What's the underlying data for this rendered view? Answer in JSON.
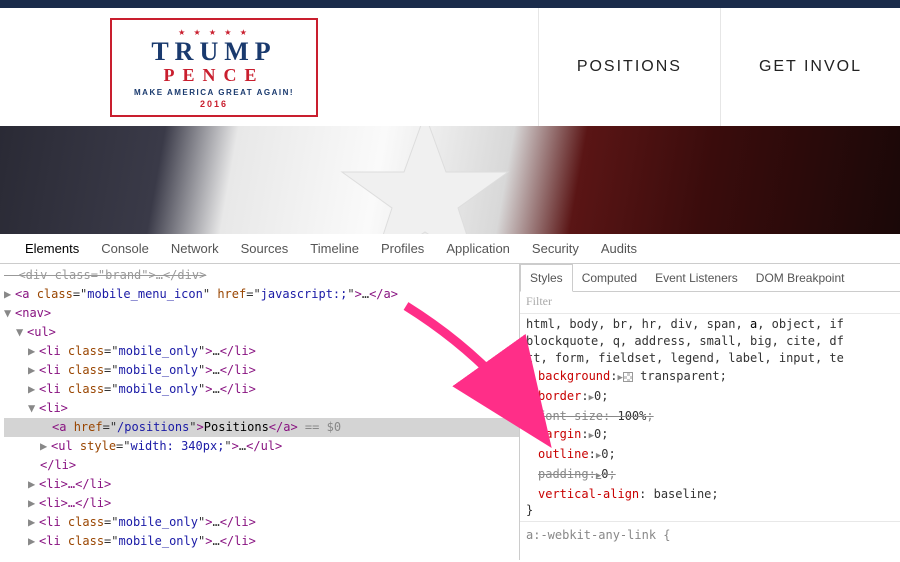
{
  "header": {
    "logo": {
      "stars": "★ ★ ★ ★ ★",
      "main": "TRUMP",
      "sub": "PENCE",
      "slogan": "MAKE AMERICA GREAT AGAIN!",
      "year": "2016"
    },
    "nav": [
      "POSITIONS",
      "GET INVOL"
    ]
  },
  "devtools": {
    "tabs": [
      "Elements",
      "Console",
      "Network",
      "Sources",
      "Timeline",
      "Profiles",
      "Application",
      "Security",
      "Audits"
    ],
    "active_tab": 0,
    "elements": {
      "l0": {
        "pre": "<div class=\"",
        "cls": "brand",
        "post": "\">…</div>"
      },
      "l1": {
        "pre": "<a class=\"",
        "cls": "mobile_menu_icon",
        "mid": "\" href=\"",
        "href": "javascript:;",
        "post": "\">…</a>"
      },
      "l2": "<nav>",
      "l3": "<ul>",
      "mo": {
        "pre": "<li class=\"",
        "cls": "mobile_only",
        "post": "\">…</li>"
      },
      "l7": "<li>",
      "sel": {
        "pre": "<a href=\"",
        "href": "/positions",
        "mid": "\">",
        "text": "Positions",
        "post": "</a>",
        "eq": " == $0"
      },
      "l9": {
        "pre": "<ul style=\"",
        "sty": "width: 340px;",
        "post": "\">…</ul>"
      },
      "l10": "</li>",
      "l11": "<li>…</li>"
    },
    "styles": {
      "tabs": [
        "Styles",
        "Computed",
        "Event Listeners",
        "DOM Breakpoint"
      ],
      "filter": "Filter",
      "selector": "html, body, br, hr, div, span, a, object, if blockquote, q, address, small, big, cite, df tt, form, fieldset, legend, label, input, te",
      "props": [
        {
          "n": "background",
          "v": "transparent",
          "strike": false,
          "expand": true,
          "swatch": true
        },
        {
          "n": "border",
          "v": "0",
          "strike": false,
          "expand": true
        },
        {
          "n": "font-size",
          "v": "100%",
          "strike": true
        },
        {
          "n": "margin",
          "v": "0",
          "strike": false,
          "expand": true
        },
        {
          "n": "outline",
          "v": "0",
          "strike": false,
          "expand": true
        },
        {
          "n": "padding",
          "v": "0",
          "strike": true,
          "expand": true
        },
        {
          "n": "vertical-align",
          "v": "baseline",
          "strike": false
        }
      ],
      "close_brace": "}",
      "selector2": "a:-webkit-any-link {"
    }
  }
}
